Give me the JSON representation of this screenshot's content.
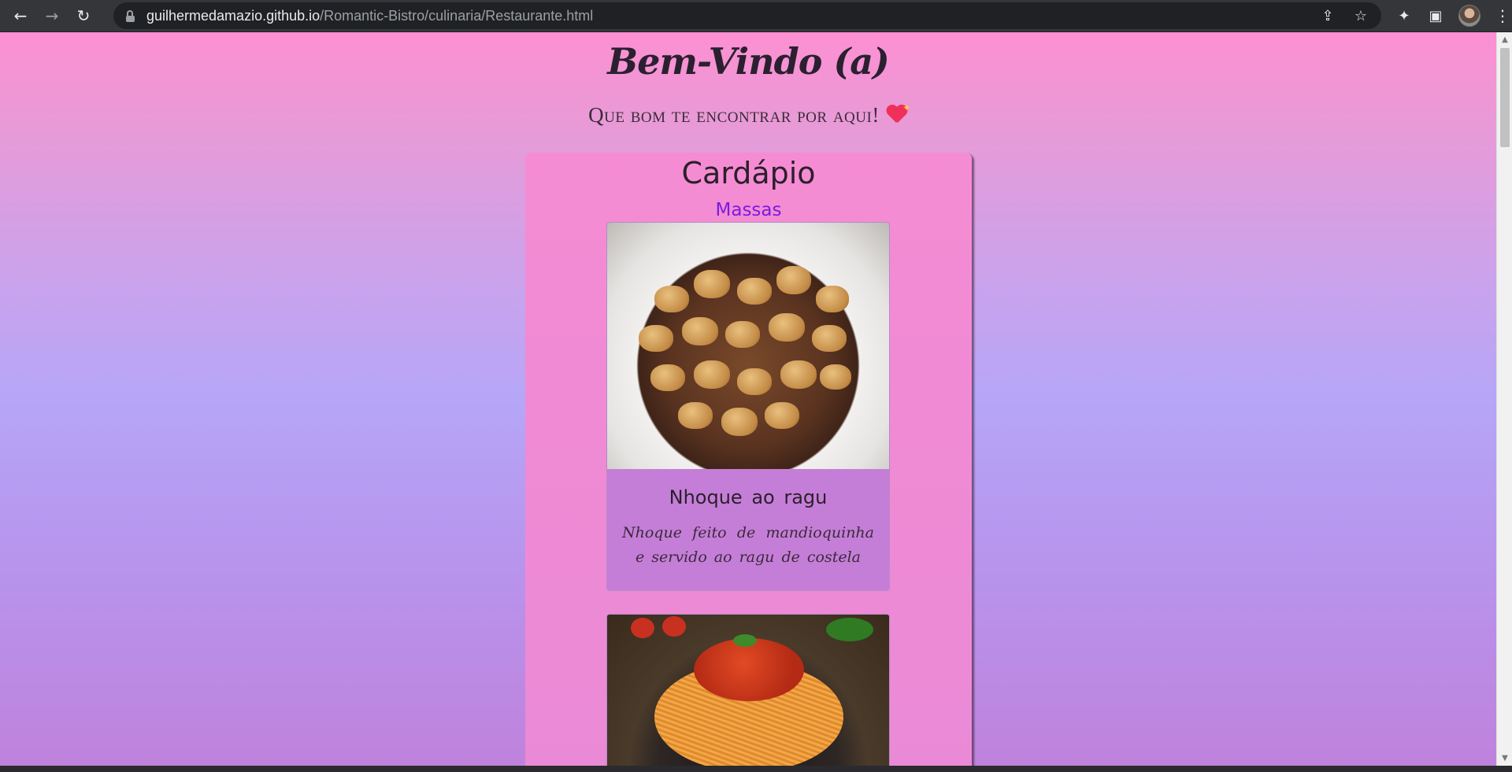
{
  "browser": {
    "url_host": "guilhermedamazio.github.io",
    "url_path": "/Romantic-Bistro/culinaria/Restaurante.html"
  },
  "page": {
    "welcome": "Bem-Vindo (a)",
    "subtitle": "Que bom te encontrar por aqui!"
  },
  "menu": {
    "title": "Cardápio",
    "section": "Massas",
    "items": [
      {
        "name": "Nhoque ao ragu",
        "description": "Nhoque feito de mandioquinha e servido ao ragu de costela"
      },
      {
        "name": "",
        "description": ""
      }
    ]
  },
  "colors": {
    "section_title": "#7b1be0",
    "card_body": "#c57ed8"
  },
  "icons": [
    "back-arrow-icon",
    "forward-arrow-icon",
    "reload-icon",
    "lock-icon",
    "share-icon",
    "star-icon",
    "extensions-icon",
    "side-panel-icon",
    "profile-avatar",
    "kebab-menu-icon",
    "sparkling-heart-emoji"
  ]
}
